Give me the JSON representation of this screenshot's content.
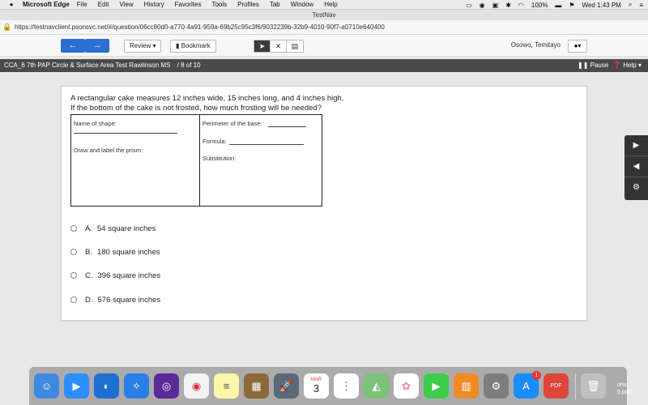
{
  "menubar": {
    "apple": "",
    "app_name": "Microsoft Edge",
    "items": [
      "File",
      "Edit",
      "View",
      "History",
      "Favorites",
      "Tools",
      "Profiles",
      "Tab",
      "Window",
      "Help"
    ],
    "battery": "100%",
    "clock": "Wed 1:43 PM"
  },
  "window": {
    "title": "TestNav"
  },
  "address": {
    "url": "https://testnavclient.psonsvc.net/#/question/06cc80d0-a770-4a91-959a-69b25c95c3f6/9032239b-32b9-4010-90f7-a0710e640400"
  },
  "toolbar": {
    "back_label": "←",
    "forward_label": "→",
    "review_label": "Review ▾",
    "bookmark_label": "Bookmark",
    "user_name": "Osowo, Temitayo",
    "user_btn_label": "▾"
  },
  "testbar": {
    "test_name": "CCA_6 7th PAP Circle & Surface Area Test Rawlinson MS",
    "progress": "/  8 of 10",
    "pause_label": "Pause",
    "help_label": "Help ▾"
  },
  "question": {
    "line1": "A rectangular cake measures 12 inches wide, 15 inches long, and 4 inches high.",
    "line2": "If the bottom of the cake is not frosted, how much frosting will be needed?",
    "worksheet": {
      "name_of_shape": "Name of shape:",
      "draw_label": "Draw and label the prism:",
      "perimeter": "Perimeter of the base:",
      "formula": "Formula:",
      "substitution": "Substitution:"
    }
  },
  "options": [
    {
      "letter": "A.",
      "text": "54 square inches"
    },
    {
      "letter": "B.",
      "text": "180 square inches"
    },
    {
      "letter": "C.",
      "text": "396 square inches"
    },
    {
      "letter": "D.",
      "text": "576 square inches"
    }
  ],
  "dock": {
    "calendar_month": "MAR",
    "calendar_day": "3",
    "appstore_badge": "1",
    "pdf_label": "PDF",
    "desktop_file": [
      "ohic",
      "5.pdf"
    ]
  }
}
